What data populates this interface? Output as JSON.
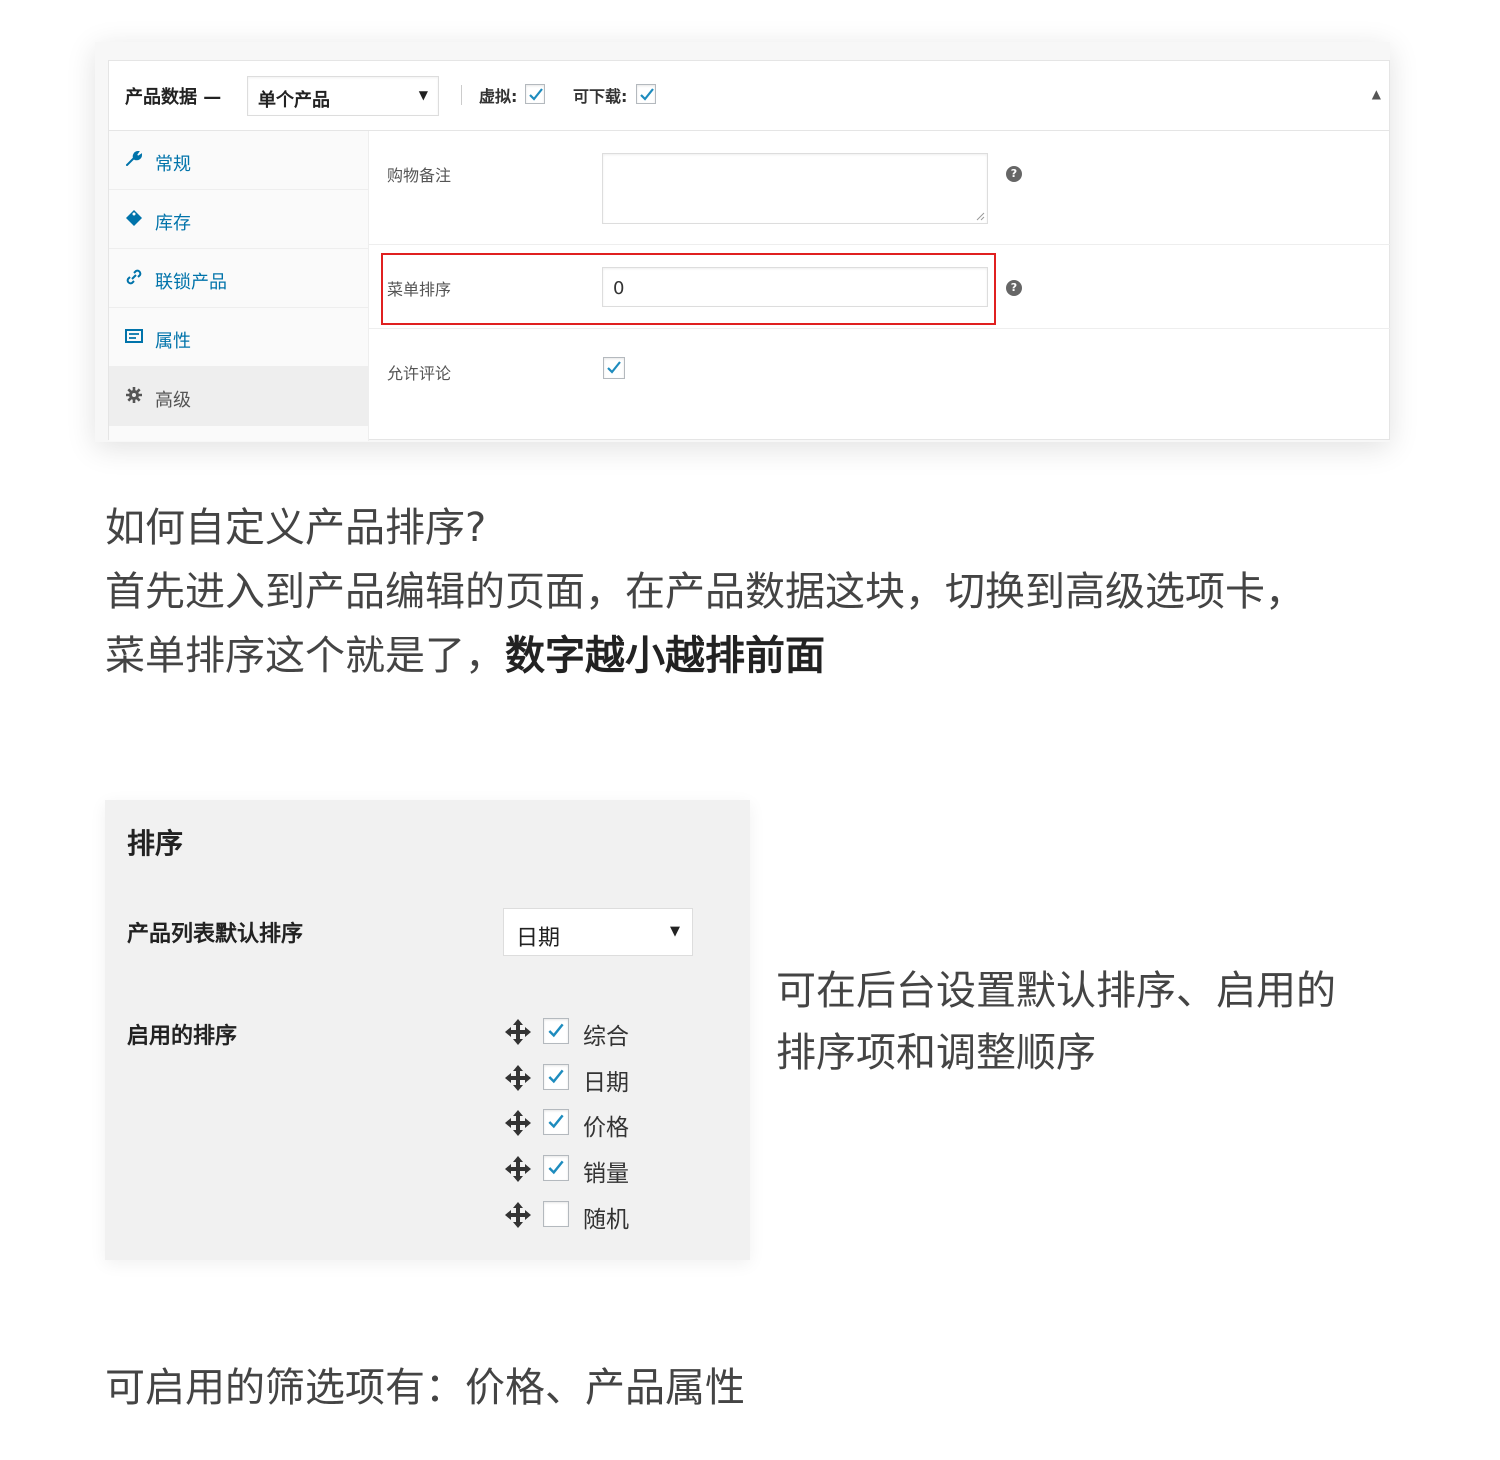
{
  "product_data": {
    "title": "产品数据 —",
    "type_select": "单个产品",
    "virtual_label": "虚拟:",
    "virtual_checked": true,
    "downloadable_label": "可下载:",
    "downloadable_checked": true,
    "tabs": [
      {
        "label": "常规",
        "icon": "wrench-icon"
      },
      {
        "label": "库存",
        "icon": "tag-icon"
      },
      {
        "label": "联锁产品",
        "icon": "link-icon"
      },
      {
        "label": "属性",
        "icon": "list-icon"
      },
      {
        "label": "高级",
        "icon": "gear-icon"
      }
    ],
    "active_tab": "高级",
    "fields": {
      "purchase_note_label": "购物备注",
      "purchase_note_value": "",
      "menu_order_label": "菜单排序",
      "menu_order_value": "0",
      "reviews_label": "允许评论",
      "reviews_checked": true
    },
    "help_glyph": "?"
  },
  "text1": {
    "line1": "如何自定义产品排序?",
    "line2": "首先进入到产品编辑的页面，在产品数据这块，切换到高级选项卡，",
    "line3_normal": "菜单排序这个就是了，",
    "line3_bold": "数字越小越排前面"
  },
  "sorting": {
    "title": "排序",
    "default_label": "产品列表默认排序",
    "default_value": "日期",
    "enabled_label": "启用的排序",
    "items": [
      {
        "label": "综合",
        "checked": true
      },
      {
        "label": "日期",
        "checked": true
      },
      {
        "label": "价格",
        "checked": true
      },
      {
        "label": "销量",
        "checked": true
      },
      {
        "label": "随机",
        "checked": false
      }
    ]
  },
  "side_text": {
    "line1": "可在后台设置默认排序、启用的",
    "line2": "排序项和调整顺序"
  },
  "text2": {
    "line1": "可启用的筛选项有：价格、产品属性"
  },
  "colors": {
    "accent_blue": "#0073aa",
    "highlight_red": "#e02020",
    "panel_gray": "#f1f1f1"
  }
}
